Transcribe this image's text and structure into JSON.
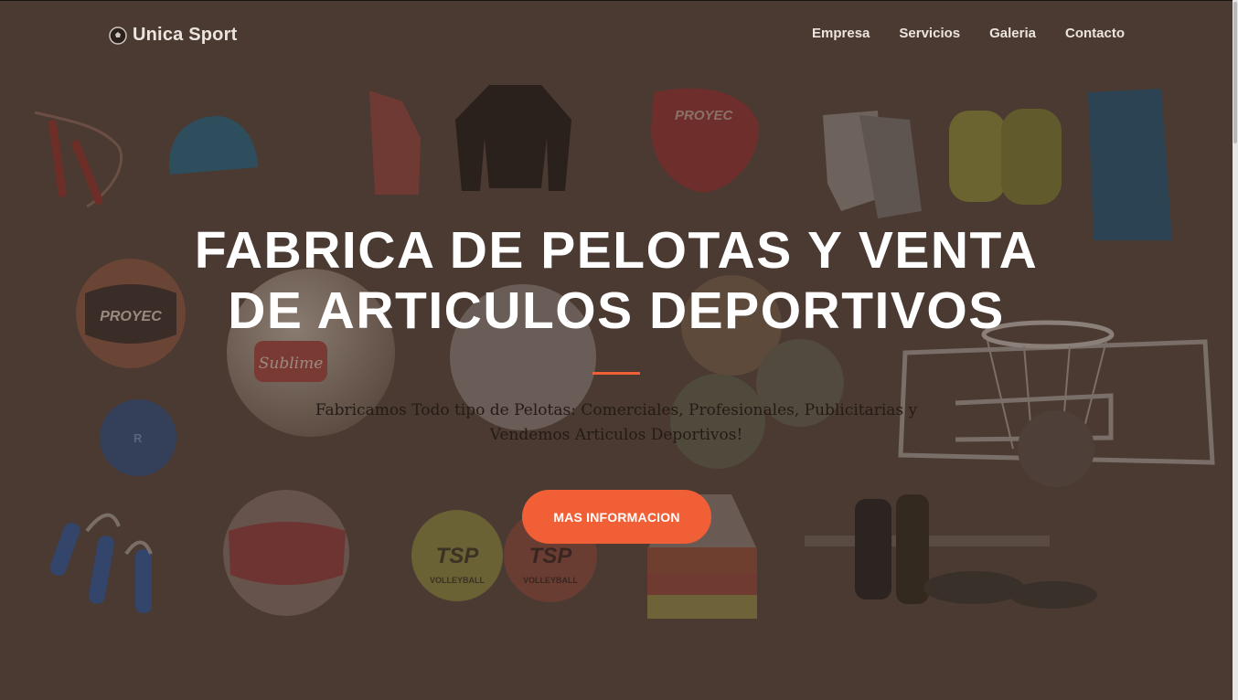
{
  "nav": {
    "brand": "Unica Sport",
    "brand_icon": "soccer-ball-icon",
    "links": [
      "Empresa",
      "Servicios",
      "Galeria",
      "Contacto"
    ]
  },
  "hero": {
    "title_line1": "FABRICA DE PELOTAS Y VENTA",
    "title_line2": "DE ARTICULOS DEPORTIVOS",
    "subtitle_line1": "Fabricamos Todo tipo de Pelotas: Comerciales, Profesionales, Publicitarias y",
    "subtitle_line2": "Vendemos Articulos Deportivos!",
    "cta_label": "MAS INFORMACION"
  },
  "background_product_text": {
    "ball_brand": "PROYEC",
    "ball_sponsor": "Sublime",
    "volleyball_brand": "TSP",
    "volleyball_text": "VOLLEYBALL",
    "ball_mark": "R"
  },
  "colors": {
    "background_overlay": "#4a3a31",
    "accent": "#f05f36",
    "title": "#ffffff",
    "nav_text": "#ece4df"
  }
}
